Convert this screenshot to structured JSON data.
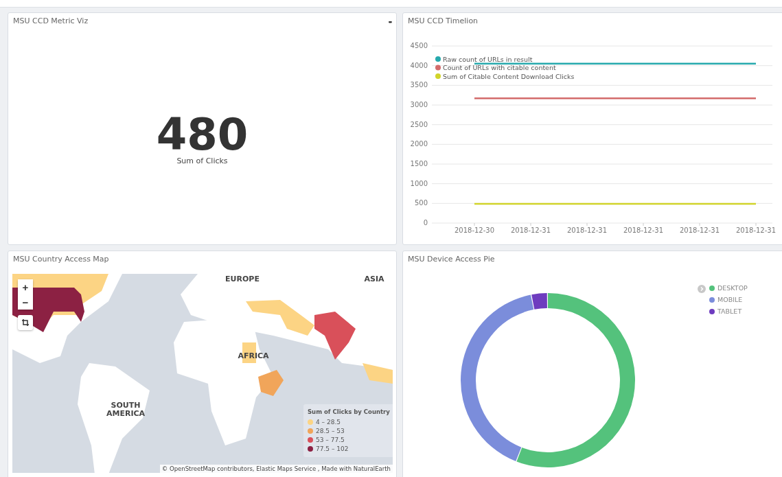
{
  "panels": [
    {
      "kind": "metric",
      "title": "MSU CCD Metric Viz",
      "menu": "▪▪▪",
      "value": "480",
      "label": "Sum of Clicks"
    },
    {
      "kind": "timeline",
      "title": "MSU CCD Timelion",
      "chart_data": {
        "type": "line",
        "grid": true,
        "legend": "top-left",
        "categories": [
          "2018-12-30",
          "2018-12-31",
          "2018-12-31",
          "2018-12-31",
          "2018-12-31",
          "2018-12-31"
        ],
        "ylim": [
          0,
          4500
        ],
        "yticks": [
          0,
          500,
          1000,
          1500,
          2000,
          2500,
          3000,
          3500,
          4000,
          4500
        ],
        "series": [
          {
            "name": "Raw count of URLs in result",
            "color": "#26a9ad",
            "values": [
              4050,
              4050,
              4050,
              4050,
              4050,
              4050
            ]
          },
          {
            "name": "Count of URLs with citable content",
            "color": "#d36b6b",
            "values": [
              3170,
              3170,
              3170,
              3170,
              3170,
              3170
            ]
          },
          {
            "name": "Sum of Citable Content Download Clicks",
            "color": "#d1d42a",
            "values": [
              490,
              490,
              490,
              490,
              490,
              490
            ]
          }
        ]
      }
    },
    {
      "kind": "map",
      "title": "MSU Country Access Map",
      "zoom_in": "+",
      "zoom_out": "−",
      "regions": [
        "EUROPE",
        "ASIA",
        "AFRICA",
        "SOUTH AMERICA"
      ],
      "legend_title": "Sum of Clicks by Country",
      "ranges": [
        {
          "label": "4 – 28.5",
          "color": "#fcd484"
        },
        {
          "label": "28.5 – 53",
          "color": "#f1a55a"
        },
        {
          "label": "53 – 77.5",
          "color": "#d9505a"
        },
        {
          "label": "77.5 – 102",
          "color": "#8c2143"
        }
      ],
      "attribution": "© OpenStreetMap contributors, Elastic Maps Service , Made with NaturalEarth"
    },
    {
      "kind": "pie",
      "title": "MSU Device Access Pie",
      "legend": [
        {
          "label": "DESKTOP",
          "color": "#54c27c"
        },
        {
          "label": "MOBILE",
          "color": "#7b8ddb"
        },
        {
          "label": "TABLET",
          "color": "#6e3cbf"
        }
      ]
    }
  ]
}
